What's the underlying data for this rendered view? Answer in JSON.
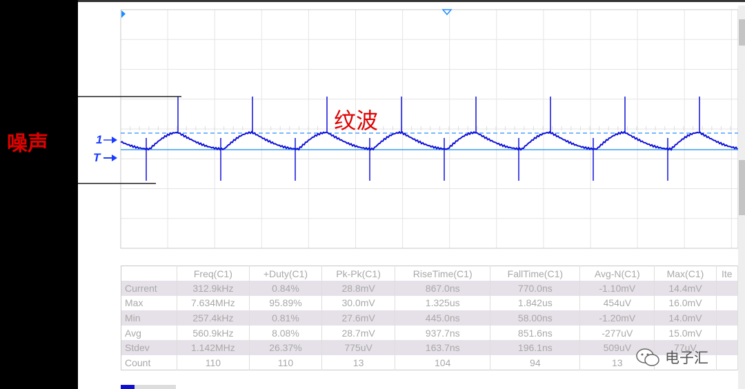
{
  "annotations": {
    "noise": "噪声",
    "ripple": "纹波"
  },
  "markers": {
    "channel": "1",
    "trigger": "T"
  },
  "colors": {
    "trace": "#1010d8",
    "ref_dashed": "#4aa0ff",
    "ref_solid": "#3a9cf0",
    "annotation": "#e00000",
    "grid": "#e4e4e4"
  },
  "measurements": {
    "headers": [
      "",
      "Freq(C1)",
      "+Duty(C1)",
      "Pk-Pk(C1)",
      "RiseTime(C1)",
      "FallTime(C1)",
      "Avg-N(C1)",
      "Max(C1)",
      "Ite"
    ],
    "rows": [
      [
        "Current",
        "312.9kHz",
        "0.84%",
        "28.8mV",
        "867.0ns",
        "770.0ns",
        "-1.10mV",
        "14.4mV",
        ""
      ],
      [
        "Max",
        "7.634MHz",
        "95.89%",
        "30.0mV",
        "1.325us",
        "1.842us",
        "454uV",
        "16.0mV",
        ""
      ],
      [
        "Min",
        "257.4kHz",
        "0.81%",
        "27.6mV",
        "445.0ns",
        "58.00ns",
        "-1.20mV",
        "14.0mV",
        ""
      ],
      [
        "Avg",
        "560.9kHz",
        "8.08%",
        "28.7mV",
        "937.7ns",
        "851.6ns",
        "-277uV",
        "15.0mV",
        ""
      ],
      [
        "Stdev",
        "1.142MHz",
        "26.37%",
        "775uV",
        "163.7ns",
        "196.1ns",
        "509uV",
        "77uV",
        ""
      ],
      [
        "Count",
        "110",
        "110",
        "13",
        "104",
        "94",
        "13",
        "",
        ""
      ]
    ]
  },
  "watermark": "电子汇"
}
